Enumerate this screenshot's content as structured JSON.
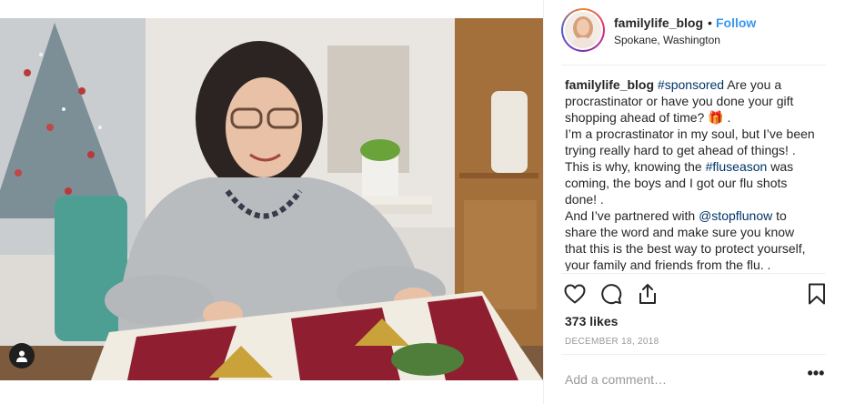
{
  "header": {
    "username": "familylife_blog",
    "separator": "•",
    "follow_label": "Follow",
    "location": "Spokane, Washington"
  },
  "caption": {
    "username": "familylife_blog",
    "l1_tag": "#sponsored",
    "l1_text": " Are you a",
    "l2": "procrastinator or have you done your gift",
    "l3_text": "shopping ahead of time? ",
    "l3_emoji": "🎁",
    "l3_end": " .",
    "l4": "I’m a procrastinator in my soul, but I’ve been",
    "l5": "trying really hard to get ahead of things! .",
    "l6_text": "This is why, knowing the ",
    "l6_tag": "#fluseason",
    "l6_end": " was",
    "l7": "coming, the boys and I got our flu shots",
    "l8": "done! .",
    "l9_text": "And I’ve partnered with ",
    "l9_tag": "@stopflunow",
    "l9_end": " to",
    "l10": "share the word and make sure you know",
    "l11": "that this is the best way to protect yourself,",
    "l12": "your family and friends from the flu. ."
  },
  "actions": {
    "icons": [
      "heart-icon",
      "comment-icon",
      "share-icon",
      "bookmark-icon"
    ]
  },
  "likes": "373 likes",
  "date": "DECEMBER 18, 2018",
  "comment": {
    "placeholder": "Add a comment…",
    "more_label": "•••"
  },
  "colors": {
    "link_blue": "#3897f0",
    "hashtag": "#003569",
    "muted": "#999999",
    "text": "#262626",
    "divider": "#efefef"
  }
}
